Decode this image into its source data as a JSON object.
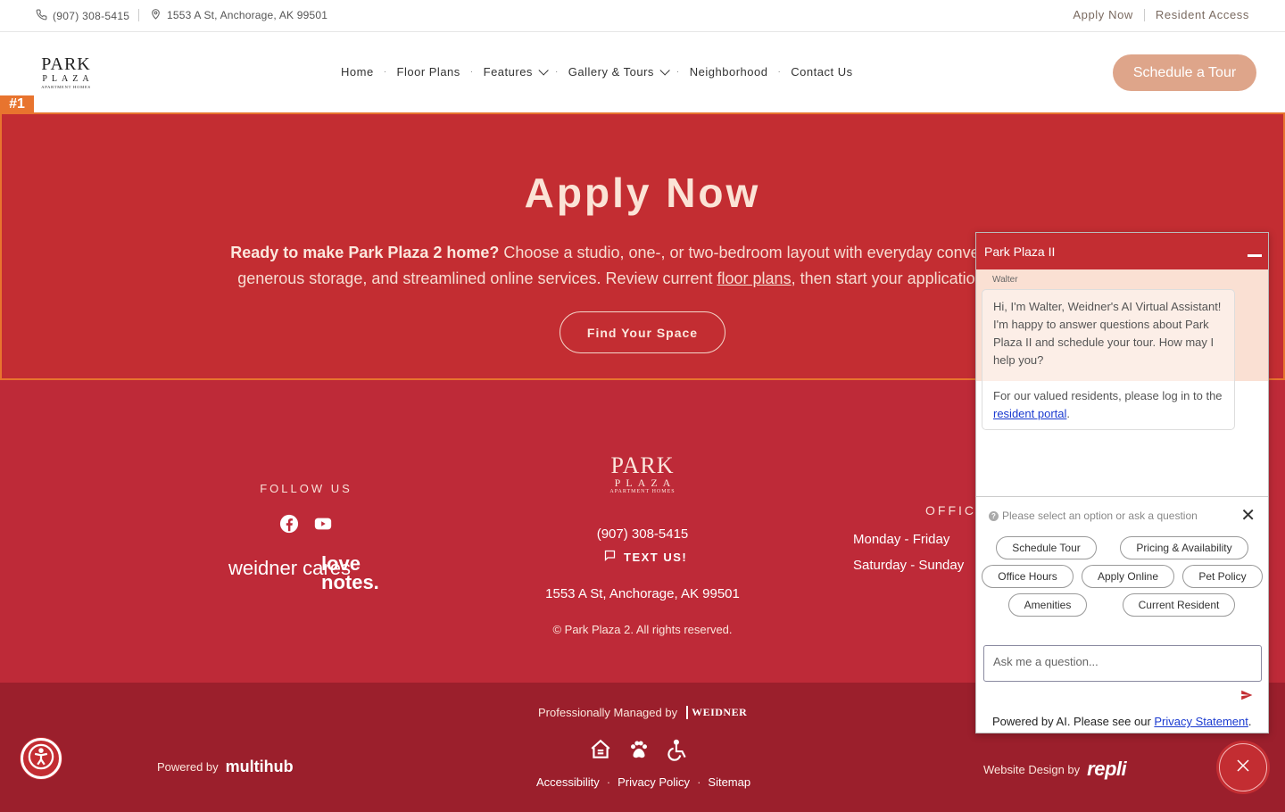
{
  "topbar": {
    "phone": "(907) 308-5415",
    "address": "1553 A St, Anchorage, AK 99501",
    "apply_now": "Apply Now",
    "resident_access": "Resident Access"
  },
  "header": {
    "logo": {
      "line1": "PARK",
      "line2": "PLAZA",
      "line3": "APARTMENT HOMES"
    },
    "nav": [
      "Home",
      "Floor Plans",
      "Features",
      "Gallery & Tours",
      "Neighborhood",
      "Contact Us"
    ],
    "cta": "Schedule a Tour"
  },
  "annotation_tag": "#1",
  "hero": {
    "title": "Apply Now",
    "lead_bold": "Ready to make Park Plaza 2 home?",
    "lead_text_1": " Choose a studio, one-, or two-bedroom layout with everyday conveniences lik",
    "lead_text_2": "generous storage, and streamlined online services. Review current ",
    "floor_plans_link": "floor plans",
    "lead_text_3": ", then start your application online w",
    "button": "Find Your Space"
  },
  "footer": {
    "follow_us": "FOLLOW US",
    "weidner_cares": "weidner cares",
    "love_notes_1": "love",
    "love_notes_2": "notes.",
    "logo": {
      "line1": "PARK",
      "line2": "PLAZA",
      "line3": "APARTMENT HOMES"
    },
    "phone": "(907) 308-5415",
    "text_us": "TEXT US!",
    "address": "1553 A St, Anchorage, AK 99501",
    "copyright": "© Park Plaza 2. All rights reserved.",
    "office_label": "OFFICE",
    "hours": [
      "Monday - Friday",
      "Saturday - Sunday"
    ]
  },
  "bottom": {
    "managed_by": "Professionally Managed by",
    "weidner_logo": "WEIDNER",
    "powered_by": "Powered by",
    "multihub": "multihub",
    "links": [
      "Accessibility",
      "Privacy Policy",
      "Sitemap"
    ],
    "website_design": "Website Design by",
    "repli": "repli"
  },
  "chat": {
    "title": "Park Plaza II",
    "agent_name": "Walter",
    "message_1": "Hi, I'm Walter, Weidner's AI Virtual Assistant! I'm happy to answer questions about Park Plaza II and schedule your tour. How may I help you?",
    "message_2_prefix": "For our valued residents, please log in to the ",
    "message_2_link": "resident portal",
    "message_2_suffix": ".",
    "options_prompt": "Please select an option or ask a question",
    "options": [
      "Schedule Tour",
      "Pricing & Availability",
      "Office Hours",
      "Apply Online",
      "Pet Policy",
      "Amenities",
      "Current Resident"
    ],
    "input_placeholder": "Ask me a question...",
    "footer_prefix": "Powered by AI. Please see our ",
    "footer_link": "Privacy Statement",
    "footer_suffix": "."
  },
  "colors": {
    "hero_red": "#c32d32",
    "footer_red": "#be2a38",
    "bottom_red": "#9b1f2c",
    "accent_peach": "#dea58a",
    "annotation_orange": "#e8742e"
  }
}
